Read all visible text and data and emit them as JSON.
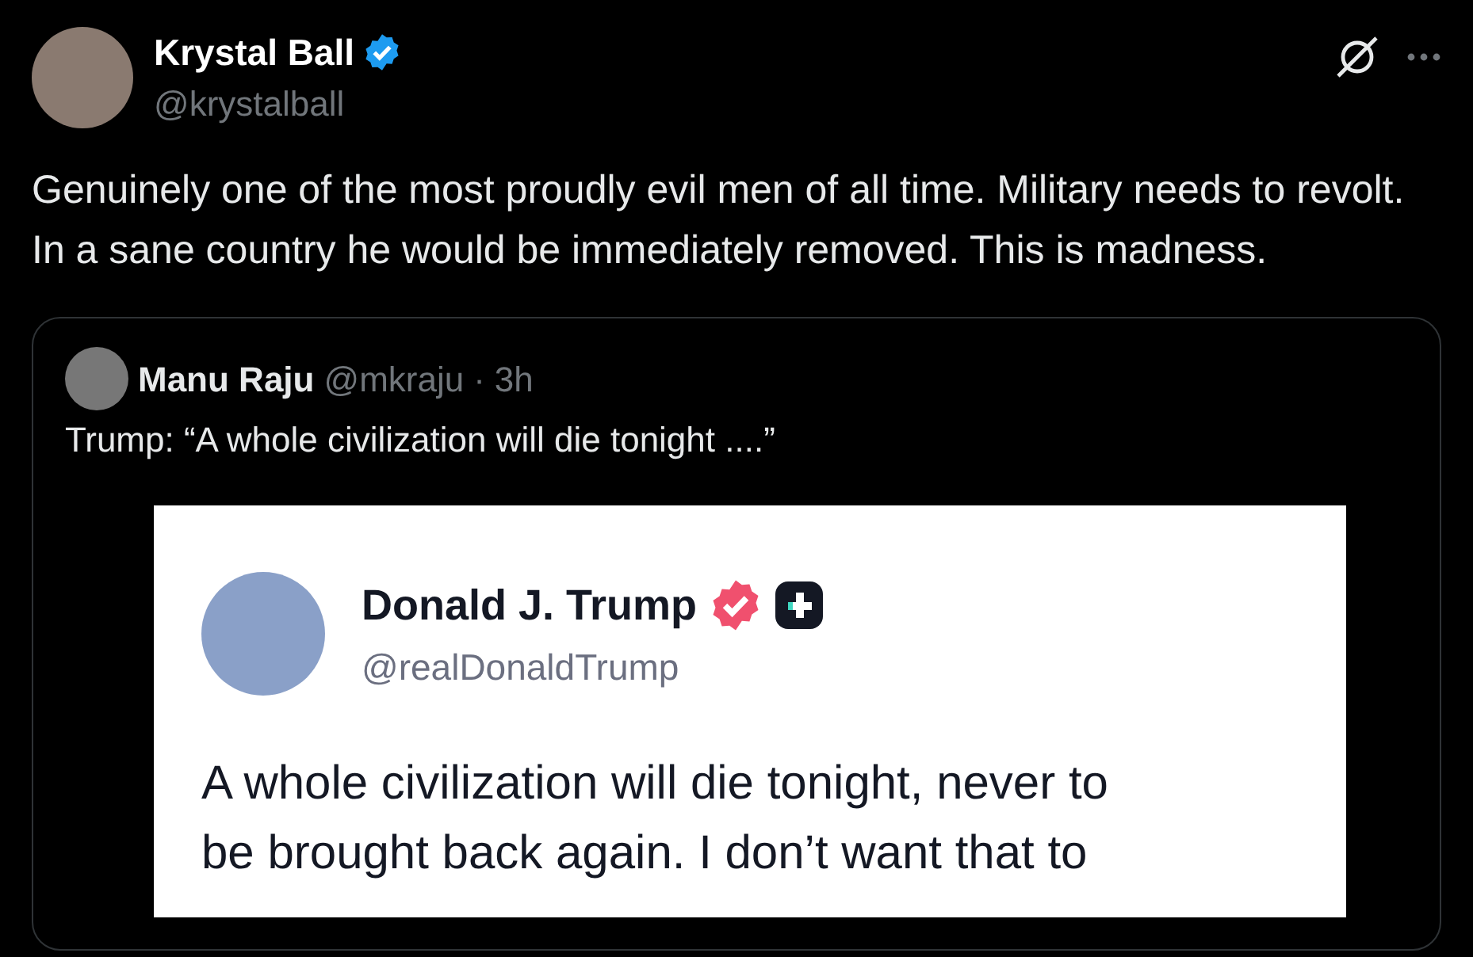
{
  "post": {
    "author": {
      "name": "Krystal Ball",
      "handle": "@krystalball",
      "verified": true
    },
    "text": "Genuinely one of the most proudly evil men of all time. Military needs to revolt. In a sane country he would be immediately removed. This is madness.",
    "quote": {
      "author": {
        "name": "Manu Raju",
        "handle": "@mkraju",
        "separator": "·",
        "time": "3h"
      },
      "text": "Trump: “A whole civilization will die tonight ....”",
      "embedded_post": {
        "author": {
          "name": "Donald J. Trump",
          "handle": "@realDonaldTrump",
          "verified": true
        },
        "lines": [
          "A whole civilization will die tonight, never to",
          "be brought back again. I don’t want that to"
        ]
      }
    }
  }
}
